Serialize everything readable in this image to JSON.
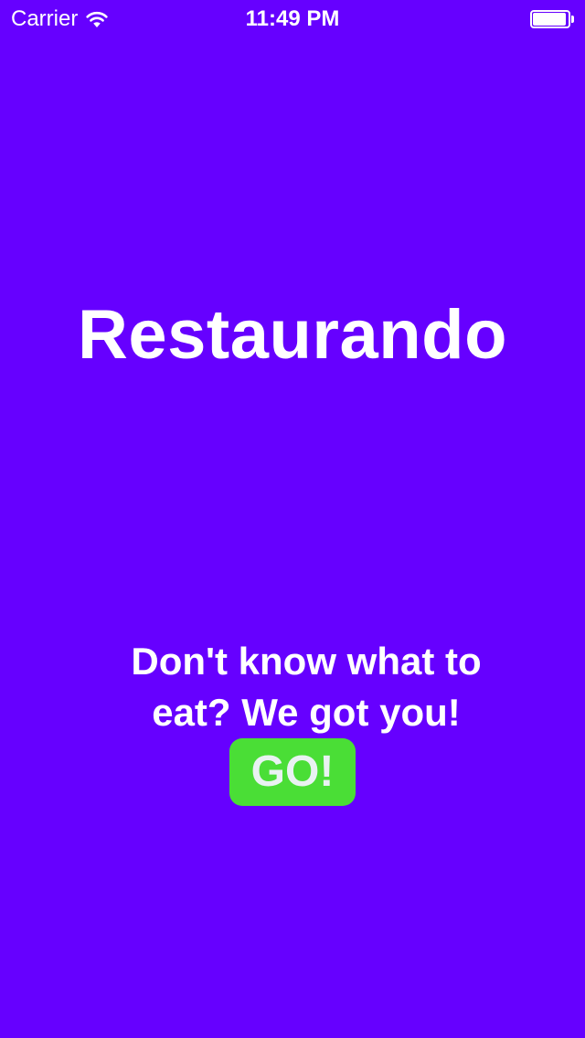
{
  "status_bar": {
    "carrier": "Carrier",
    "time": "11:49 PM",
    "wifi_icon": "wifi-icon",
    "battery_icon": "battery-icon",
    "battery_level": 1.0
  },
  "main": {
    "title": "Restaurando",
    "tagline": "Don't know what to eat? We got you!",
    "go_button_label": "GO!"
  },
  "colors": {
    "background": "#6600ff",
    "text": "#ffffff",
    "button_background": "#4ade36",
    "button_text": "#e9f2f2"
  }
}
